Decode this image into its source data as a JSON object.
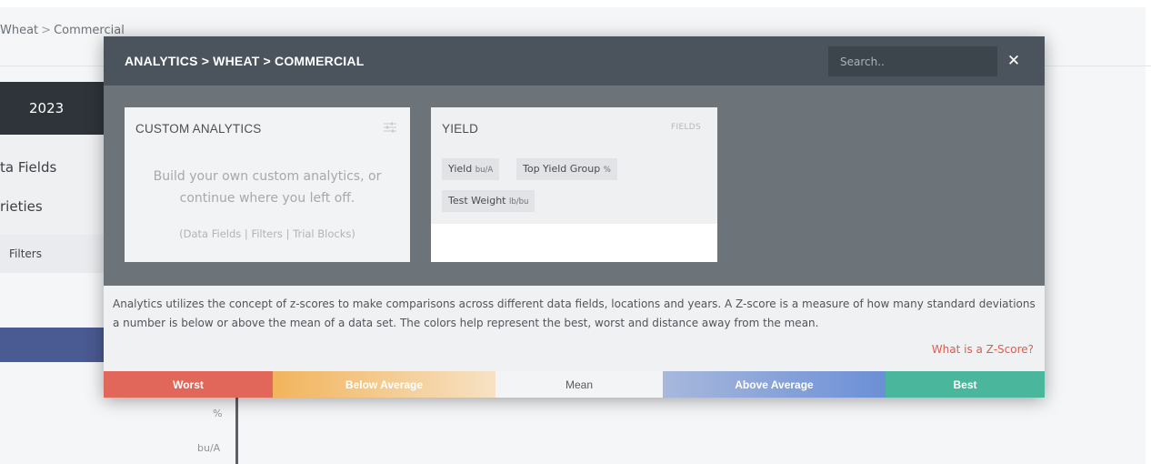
{
  "background": {
    "breadcrumb": [
      "Wheat",
      "Commercial"
    ],
    "breadcrumb_sep": ">",
    "year": "2023",
    "side_items": [
      "ta Fields",
      "rieties"
    ],
    "filters_label": "Filters",
    "units": [
      "%",
      "bu/A"
    ]
  },
  "modal": {
    "title": "ANALYTICS > WHEAT > COMMERCIAL",
    "search_placeholder": "Search..",
    "close_icon": "close-icon",
    "custom_card": {
      "title": "CUSTOM ANALYTICS",
      "icon": "sliders-icon",
      "desc_line1": "Build your own custom analytics, or",
      "desc_line2": "continue where you left off.",
      "links": {
        "open": "(",
        "data_fields": "Data Fields",
        "sep1": " | ",
        "filters": "Filters",
        "sep2": " | ",
        "trial_blocks": "Trial Blocks",
        "close": ")"
      }
    },
    "yield_card": {
      "title": "YIELD",
      "tag": "FIELDS",
      "chips": [
        {
          "label": "Yield",
          "unit": "bu/A"
        },
        {
          "label": "Top Yield Group",
          "unit": "%"
        },
        {
          "label": "Test Weight",
          "unit": "lb/bu"
        }
      ]
    },
    "info": {
      "text": "Analytics utilizes the concept of z-scores to make comparisons across different data fields, locations and years. A Z-score is a measure of how many standard deviations a number is below or above the mean of a data set. The colors help represent the best, worst and distance away from the mean.",
      "link": "What is a Z-Score?"
    },
    "legend": {
      "worst": "Worst",
      "below": "Below Average",
      "mean": "Mean",
      "above": "Above Average",
      "best": "Best"
    }
  },
  "colors": {
    "modal_header": "#4b545c",
    "modal_body": "#6c7379",
    "worst": "#e0675a",
    "below": "#f2b45c",
    "mean": "#f3f4f6",
    "above": "#6b8fd6",
    "best": "#4ab79c",
    "link": "#e05a4e"
  }
}
